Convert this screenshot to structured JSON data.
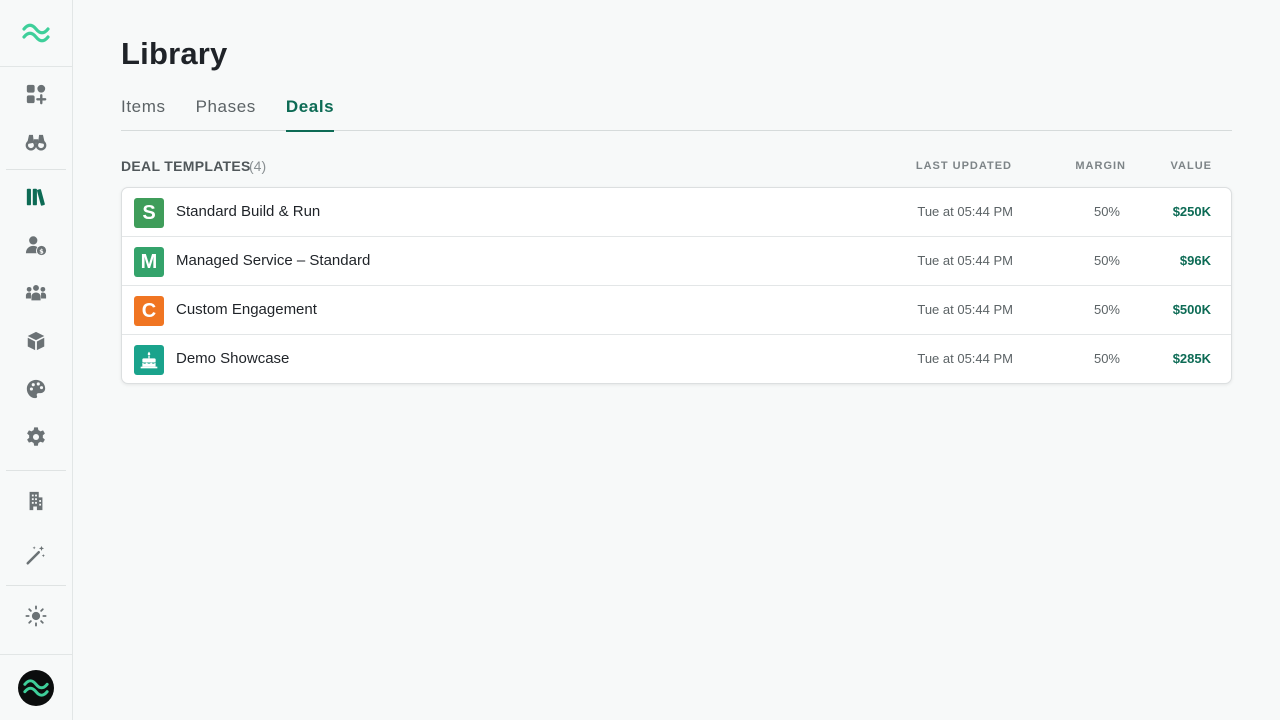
{
  "colors": {
    "accent": "#0d6b55",
    "logo": "#3ecf9a",
    "icon_default": "#6b7275",
    "icon_active": "#0d6b55"
  },
  "sidebar": {
    "logo_icon": "wave-logo-icon",
    "items": [
      {
        "icon": "apps-add-icon",
        "active": false
      },
      {
        "icon": "binoculars-icon",
        "active": false
      },
      {
        "icon": "library-icon",
        "active": true
      },
      {
        "icon": "user-dollar-icon",
        "active": false
      },
      {
        "icon": "team-icon",
        "active": false
      },
      {
        "icon": "box-icon",
        "active": false
      },
      {
        "icon": "palette-icon",
        "active": false
      },
      {
        "icon": "gear-icon",
        "active": false
      },
      {
        "icon": "building-icon",
        "active": false
      },
      {
        "icon": "magic-wand-icon",
        "active": false
      },
      {
        "icon": "sun-icon",
        "active": false
      }
    ],
    "avatar_icon": "wave-logo-icon"
  },
  "page": {
    "title": "Library",
    "tabs": [
      {
        "label": "Items",
        "active": false
      },
      {
        "label": "Phases",
        "active": false
      },
      {
        "label": "Deals",
        "active": true
      }
    ]
  },
  "deals": {
    "section_title": "DEAL TEMPLATES",
    "count": "(4)",
    "columns": {
      "updated": "LAST UPDATED",
      "margin": "MARGIN",
      "value": "VALUE"
    },
    "rows": [
      {
        "badge": "S",
        "badge_color": "#3f9d5a",
        "name": "Standard Build & Run",
        "updated": "Tue at 05:44 PM",
        "margin": "50%",
        "value": "$250K"
      },
      {
        "badge": "M",
        "badge_color": "#34a36b",
        "name": "Managed Service – Standard",
        "updated": "Tue at 05:44 PM",
        "margin": "50%",
        "value": "$96K"
      },
      {
        "badge": "C",
        "badge_color": "#f07522",
        "name": "Custom Engagement",
        "updated": "Tue at 05:44 PM",
        "margin": "50%",
        "value": "$500K"
      },
      {
        "badge": "cake-icon",
        "badge_color": "#1aa38c",
        "name": "Demo Showcase",
        "updated": "Tue at 05:44 PM",
        "margin": "50%",
        "value": "$285K"
      }
    ]
  }
}
